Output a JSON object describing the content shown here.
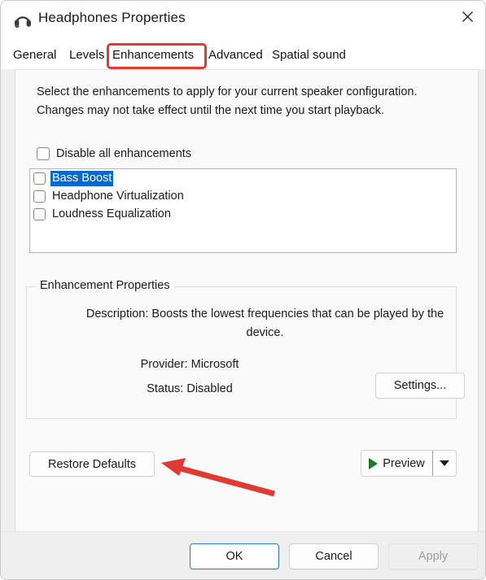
{
  "window": {
    "title": "Headphones Properties",
    "icon": "headphones-icon",
    "close_label": "✕"
  },
  "tabs": [
    {
      "label": "General",
      "selected": false
    },
    {
      "label": "Levels",
      "selected": false
    },
    {
      "label": "Enhancements",
      "selected": true
    },
    {
      "label": "Advanced",
      "selected": false
    },
    {
      "label": "Spatial sound",
      "selected": false
    }
  ],
  "panel": {
    "intro": "Select the enhancements to apply for your current speaker configuration. Changes may not take effect until the next time you start playback.",
    "disable_all": {
      "label": "Disable all enhancements",
      "checked": false
    },
    "enhancements": [
      {
        "label": "Bass Boost",
        "checked": false,
        "selected": true
      },
      {
        "label": "Headphone Virtualization",
        "checked": false,
        "selected": false
      },
      {
        "label": "Loudness Equalization",
        "checked": false,
        "selected": false
      }
    ],
    "group": {
      "title": "Enhancement Properties",
      "description": "Description: Boosts the lowest frequencies that can be played by the device.",
      "provider": "Provider: Microsoft",
      "status": "Status: Disabled",
      "settings_label": "Settings..."
    },
    "restore_defaults_label": "Restore Defaults",
    "preview": {
      "label": "Preview",
      "play_icon": "play-triangle-icon",
      "dropdown_icon": "chevron-down-icon"
    }
  },
  "footer": {
    "ok_label": "OK",
    "cancel_label": "Cancel",
    "apply_label": "Apply",
    "apply_disabled": true
  },
  "annotations": {
    "highlight_target": "Enhancements",
    "arrow_target": "Restore Defaults",
    "color": "#e03a33"
  }
}
